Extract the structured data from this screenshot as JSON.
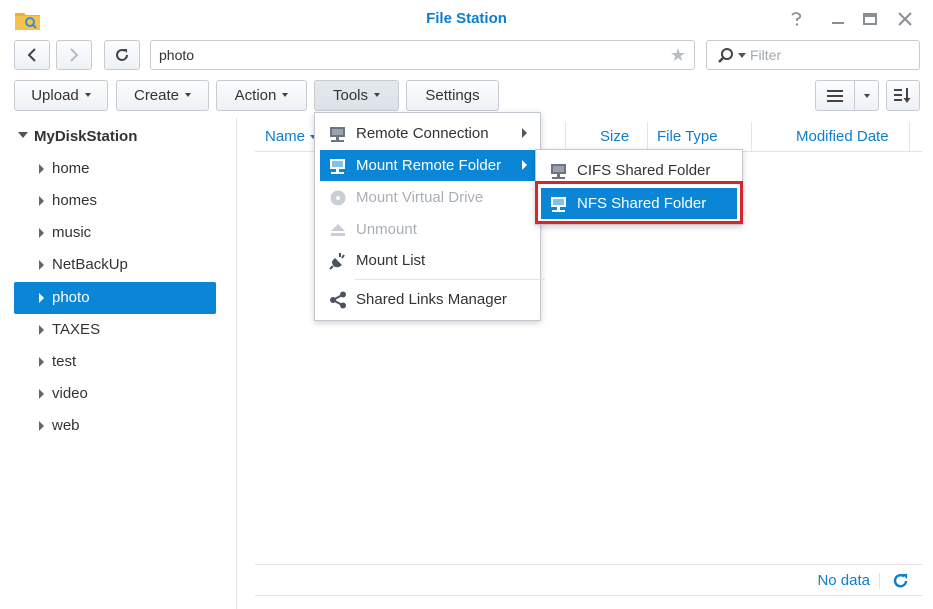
{
  "window": {
    "title": "File Station",
    "controls": {
      "help_icon": "help-icon",
      "minimize_icon": "minimize-icon",
      "maximize_icon": "maximize-icon",
      "close_icon": "close-icon"
    }
  },
  "nav": {
    "path": "photo",
    "filter_placeholder": "Filter"
  },
  "toolbar": {
    "upload_label": "Upload",
    "create_label": "Create",
    "action_label": "Action",
    "tools_label": "Tools",
    "settings_label": "Settings"
  },
  "tree": {
    "root": "MyDiskStation",
    "items": [
      {
        "label": "home"
      },
      {
        "label": "homes"
      },
      {
        "label": "music"
      },
      {
        "label": "NetBackUp"
      },
      {
        "label": "photo",
        "selected": true
      },
      {
        "label": "TAXES"
      },
      {
        "label": "test"
      },
      {
        "label": "video"
      },
      {
        "label": "web"
      }
    ]
  },
  "grid": {
    "columns": [
      "Name",
      "Size",
      "File Type",
      "Modified Date"
    ],
    "empty_text": "No data"
  },
  "tools_menu": {
    "items": [
      {
        "label": "Remote Connection",
        "submenu": true
      },
      {
        "label": "Mount Remote Folder",
        "submenu": true,
        "highlighted": true
      },
      {
        "label": "Mount Virtual Drive",
        "disabled": true
      },
      {
        "label": "Unmount",
        "disabled": true
      },
      {
        "label": "Mount List"
      },
      {
        "label": "Shared Links Manager"
      }
    ]
  },
  "mount_submenu": {
    "items": [
      {
        "label": "CIFS Shared Folder"
      },
      {
        "label": "NFS Shared Folder",
        "highlighted": true
      }
    ]
  },
  "colors": {
    "accent": "#0b86d7",
    "title": "#0b7fcf",
    "highlight_box": "#d9232e"
  }
}
